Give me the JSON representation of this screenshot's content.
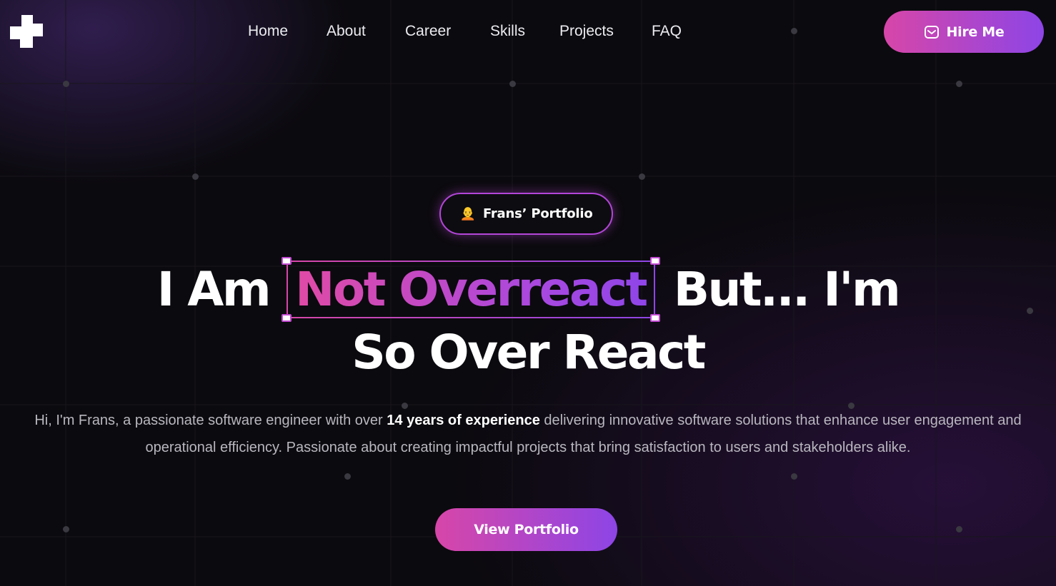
{
  "nav": {
    "items": [
      {
        "label": "Home"
      },
      {
        "label": "About"
      },
      {
        "label": "Career"
      },
      {
        "label": "Skills"
      },
      {
        "label": "Projects"
      },
      {
        "label": "FAQ"
      }
    ],
    "hire_button": {
      "label": "Hire Me",
      "icon": "mail-icon"
    }
  },
  "logo": {
    "icon": "plus-shape-logo"
  },
  "badge": {
    "emoji": "🧑‍🦲",
    "label": "Frans’ Portfolio"
  },
  "headline": {
    "line1_prefix": "I Am",
    "highlight": "Not Overreact",
    "line1_suffix": "But... I'm",
    "line2": "So Over React"
  },
  "intro": {
    "before": "Hi, I'm Frans, a passionate software engineer with over ",
    "emphasis": "14 years of experience",
    "after": " delivering innovative software solutions that enhance user engagement and operational efficiency. Passionate about creating impactful projects that bring satisfaction to users and stakeholders alike."
  },
  "cta": {
    "label": "View Portfolio"
  },
  "colors": {
    "background": "#0b0a0e",
    "accent_start": "#d746a8",
    "accent_end": "#8d45e6",
    "text": "#ffffff",
    "muted_text": "#b9b7bf"
  }
}
